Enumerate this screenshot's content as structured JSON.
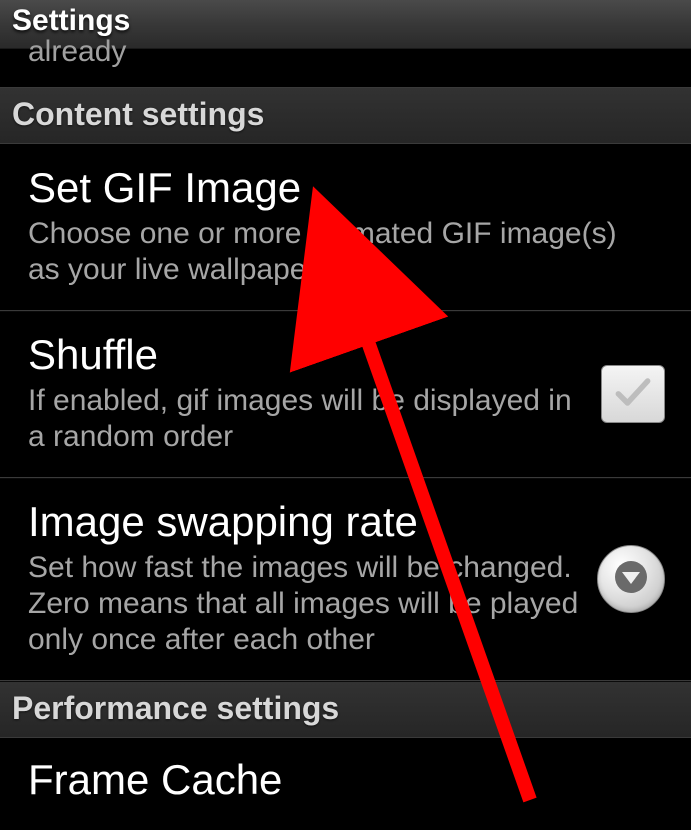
{
  "titlebar": {
    "title": "Settings"
  },
  "partial": {
    "text": "already"
  },
  "sections": {
    "content": {
      "header": "Content settings",
      "items": {
        "set_gif": {
          "title": "Set GIF Image",
          "sub": "Choose one or more animated GIF image(s) as your live wallpaper"
        },
        "shuffle": {
          "title": "Shuffle",
          "sub": "If enabled, gif images will be displayed in a random order",
          "checked": false
        },
        "swap_rate": {
          "title": "Image swapping rate",
          "sub": "Set how fast the images will be changed. Zero means that all images will be played only once after each other"
        }
      }
    },
    "performance": {
      "header": "Performance settings",
      "items": {
        "frame_cache": {
          "title": "Frame Cache"
        }
      }
    }
  },
  "annotation": {
    "color": "#ff0000"
  }
}
